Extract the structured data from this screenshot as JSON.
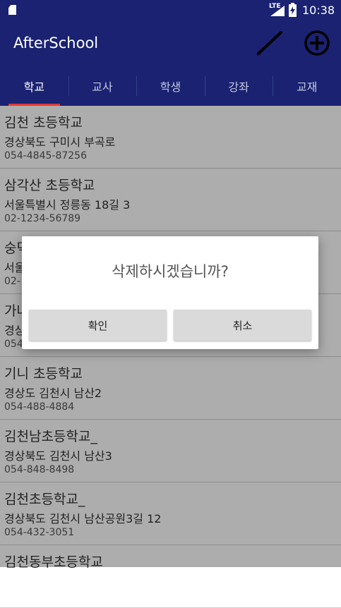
{
  "status_bar": {
    "network": "LTE",
    "time": "10:38"
  },
  "app_bar": {
    "title": "AfterSchool",
    "edit_icon": "pen-icon",
    "add_icon": "add-circle-icon"
  },
  "tabs": [
    {
      "label": "학교",
      "active": true
    },
    {
      "label": "교사",
      "active": false
    },
    {
      "label": "학생",
      "active": false
    },
    {
      "label": "강좌",
      "active": false
    },
    {
      "label": "교재",
      "active": false
    }
  ],
  "schools": [
    {
      "name": "김천 초등학교",
      "address": "경상북도 구미시 부곡로",
      "phone": "054-4845-87256"
    },
    {
      "name": "삼각산 초등학교",
      "address": "서울특별시 정릉동 18길 3",
      "phone": "02-1234-56789"
    },
    {
      "name": "숭덕",
      "address": "서울",
      "phone": "02-"
    },
    {
      "name": "가나",
      "address": "경상",
      "phone": "054"
    },
    {
      "name": "기니 초등학교",
      "address": "경상도 김천시 남산2",
      "phone": "054-488-4884"
    },
    {
      "name": "김천남초등학교_",
      "address": "경상북도 김천시 남산3",
      "phone": "054-848-8498"
    },
    {
      "name": "김천초등학교_",
      "address": "경상북도 김천시 남산공원3길 12",
      "phone": "054-432-3051"
    },
    {
      "name": "김천동부초등학교",
      "address": "",
      "phone": ""
    }
  ],
  "dialog": {
    "message": "삭제하시겠습니까?",
    "confirm_label": "확인",
    "cancel_label": "취소"
  },
  "colors": {
    "primary": "#1a2271",
    "tab_indicator": "#e53935",
    "dialog_button": "#d9dad9"
  }
}
